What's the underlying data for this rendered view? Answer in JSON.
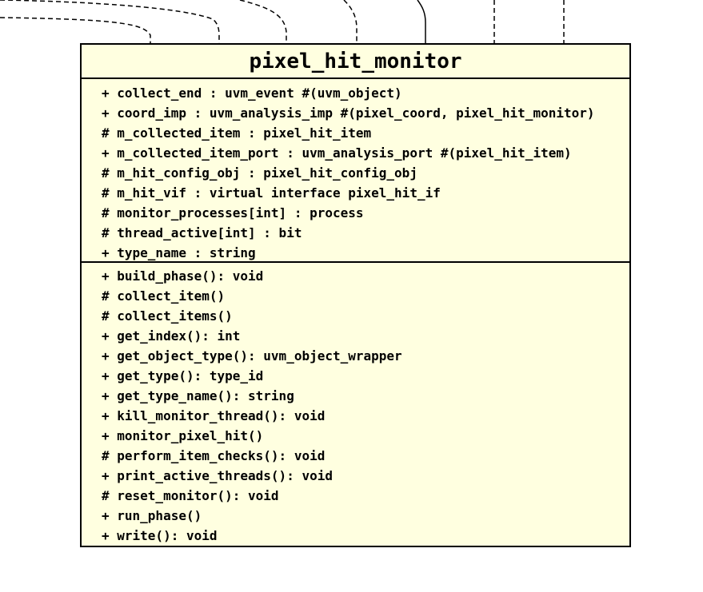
{
  "class_name": "pixel_hit_monitor",
  "colors": {
    "class_fill": "#ffffe0",
    "stroke": "#000000",
    "background": "#ffffff"
  },
  "attributes": [
    "+ collect_end : uvm_event #(uvm_object)",
    "+ coord_imp : uvm_analysis_imp #(pixel_coord, pixel_hit_monitor)",
    "# m_collected_item : pixel_hit_item",
    "+ m_collected_item_port : uvm_analysis_port #(pixel_hit_item)",
    "# m_hit_config_obj : pixel_hit_config_obj",
    "# m_hit_vif : virtual interface pixel_hit_if",
    "# monitor_processes[int] : process",
    "# thread_active[int] : bit",
    "+ type_name : string"
  ],
  "operations": [
    "+ build_phase(): void",
    "# collect_item()",
    "# collect_items()",
    "+ get_index(): int",
    "+ get_object_type(): uvm_object_wrapper",
    "+ get_type(): type_id",
    "+ get_type_name(): string",
    "+ kill_monitor_thread(): void",
    "+ monitor_pixel_hit()",
    "# perform_item_checks(): void",
    "+ print_active_threads(): void",
    "# reset_monitor(): void",
    "+ run_phase()",
    "+ write(): void"
  ]
}
